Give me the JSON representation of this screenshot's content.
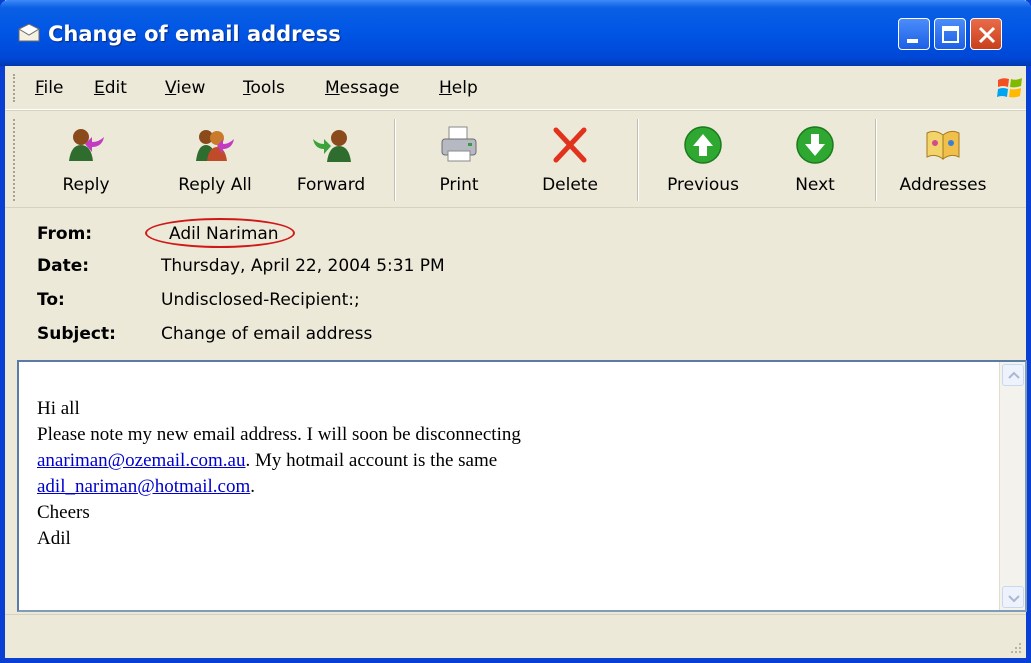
{
  "window": {
    "title": "Change of email address"
  },
  "menu": [
    {
      "label": "File",
      "hotkey": "F",
      "rest": "ile"
    },
    {
      "label": "Edit",
      "hotkey": "E",
      "rest": "dit"
    },
    {
      "label": "View",
      "hotkey": "V",
      "rest": "iew"
    },
    {
      "label": "Tools",
      "hotkey": "T",
      "rest": "ools"
    },
    {
      "label": "Message",
      "hotkey": "M",
      "rest": "essage"
    },
    {
      "label": "Help",
      "hotkey": "H",
      "rest": "elp"
    }
  ],
  "toolbar": {
    "reply": "Reply",
    "reply_all": "Reply All",
    "forward": "Forward",
    "print": "Print",
    "delete": "Delete",
    "previous": "Previous",
    "next": "Next",
    "addresses": "Addresses"
  },
  "header": {
    "from_label": "From:",
    "from_value": "Adil Nariman",
    "date_label": "Date:",
    "date_value": "Thursday, April 22, 2004 5:31 PM",
    "to_label": "To:",
    "to_value": "Undisclosed-Recipient:;",
    "subject_label": "Subject:",
    "subject_value": "Change of email address"
  },
  "message": {
    "line1": "Hi all",
    "line2": "Please note my new email address.  I will soon be disconnecting",
    "link1": "anariman@ozemail.com.au",
    "line3_rest": ".  My hotmail account is the same",
    "link2": "adil_nariman@hotmail.com",
    "line4_rest": ".",
    "line5": "Cheers",
    "line6": "Adil"
  },
  "colors": {
    "titlebar": "#0055e5",
    "chrome": "#ece9d8",
    "link": "#0000cc",
    "highlight_oval": "#d01818"
  }
}
